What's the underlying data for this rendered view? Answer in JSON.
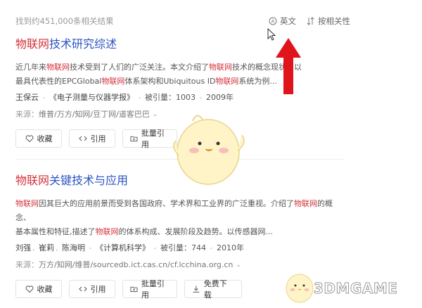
{
  "header": {
    "result_count": "找到约451,000条相关结果",
    "lang_label": "英文",
    "sort_label": "按相关性"
  },
  "results": [
    {
      "title_hl": "物联网",
      "title_rest": "技术研究综述",
      "abstract": [
        {
          "t": "近几年来",
          "hl": false
        },
        {
          "t": "物联网",
          "hl": true
        },
        {
          "t": "技术受到了人们的广泛关注。本文介绍了",
          "hl": false
        },
        {
          "t": "物联网",
          "hl": true
        },
        {
          "t": "技术的概念",
          "hl": false
        },
        {
          "t": "现状。以",
          "hl": false
        },
        {
          "t": "最具代表性的EPCGlobal",
          "hl": false
        },
        {
          "t": "物联网",
          "hl": true
        },
        {
          "t": "体系架构和Ubiquitous ID",
          "hl": false
        },
        {
          "t": "物联网",
          "hl": true
        },
        {
          "t": "系统为例...",
          "hl": false
        }
      ],
      "authors": [
        "王保云"
      ],
      "journal": "《电子测量与仪器学报》",
      "cited": "被引量：1003",
      "year": "2009年",
      "source_label": "来源：",
      "sources": [
        "维普",
        "万方",
        "知网",
        "豆丁网",
        "道客巴巴"
      ],
      "actions": [
        "收藏",
        "引用",
        "批量引用"
      ]
    },
    {
      "title_hl": "物联网",
      "title_rest": "关键技术与应用",
      "abstract": [
        {
          "t": "物联网",
          "hl": true
        },
        {
          "t": "因其巨大的应用前景而受到各国政府、学术界和工业界的广泛重视。介绍了",
          "hl": false
        },
        {
          "t": "物联网",
          "hl": true
        },
        {
          "t": "的概念、",
          "hl": false
        },
        {
          "t": "基本属性和特征,描述了",
          "hl": false
        },
        {
          "t": "物联网",
          "hl": true
        },
        {
          "t": "的体系构成、发展阶段及趋势。以传感器网...",
          "hl": false
        }
      ],
      "authors": [
        "刘强",
        "崔莉",
        "陈海明"
      ],
      "journal": "《计算机科学》",
      "cited": "被引量：744",
      "year": "2010年",
      "source_label": "来源：",
      "sources": [
        "万方",
        "知网",
        "维普",
        "sourcedb.ict.cas.cn",
        "cf.lcchina.org.cn"
      ],
      "actions": [
        "收藏",
        "引用",
        "批量引用",
        "免费下载"
      ]
    }
  ],
  "watermark": "3DMGAME",
  "colors": {
    "link": "#2b54c2",
    "highlight": "#d4313b",
    "arrow": "#e0141b"
  }
}
